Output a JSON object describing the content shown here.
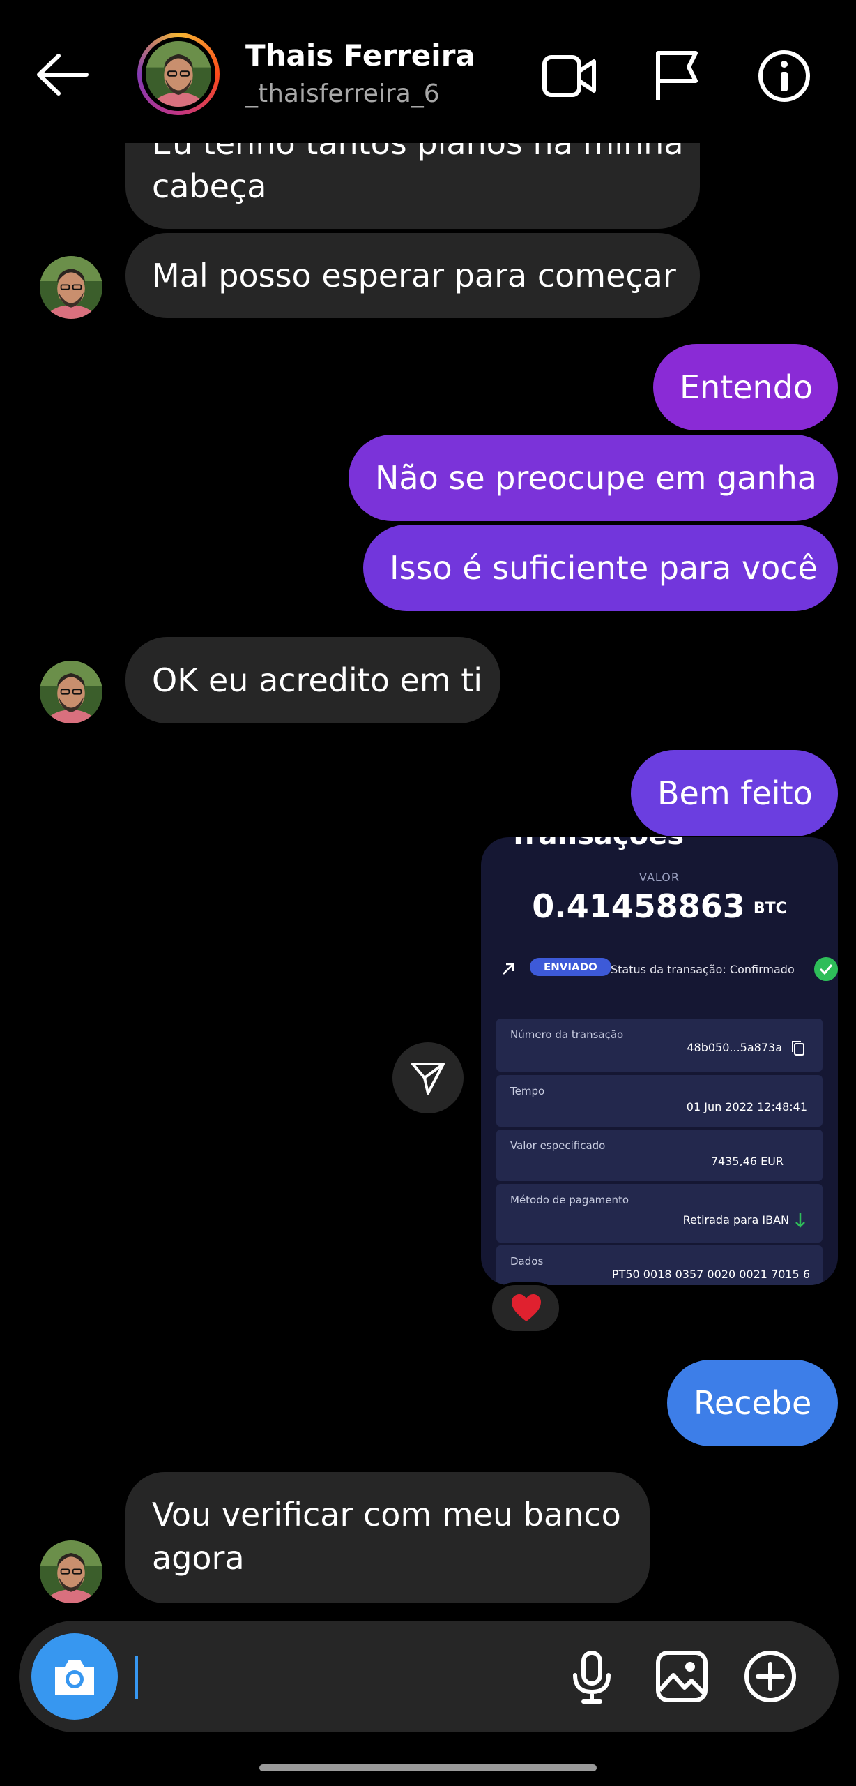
{
  "header": {
    "name": "Thais Ferreira",
    "handle": "_thaisferreira_6",
    "icons": [
      "back-arrow-icon",
      "video-call-icon",
      "report-flag-icon",
      "info-icon"
    ]
  },
  "messages": {
    "m1_line1": "Eu tenho tantos planos na minha",
    "m1_line2": "cabeça",
    "m2": "Mal posso esperar para começar",
    "m3": "Entendo",
    "m4": "Não se preocupe em ganha",
    "m5": "Isso é suficiente para você",
    "m6": "OK eu acredito em ti",
    "m7": "Bem feito",
    "m8": "Recebe",
    "m9_line1": "Vou verificar com meu banco",
    "m9_line2": "agora"
  },
  "colors": {
    "incoming": "#262626",
    "outgoing_purple": "#8a2bd6",
    "outgoing_violet": "#6b3ee0",
    "outgoing_blue": "#3d7ee8",
    "accent": "#3797f0"
  },
  "transaction": {
    "header_cut": "Transações",
    "value_label": "VALOR",
    "amount": "0.41458863",
    "currency": "BTC",
    "sent_badge": "ENVIADO",
    "status": "Status da transação: Confirmado",
    "rows": [
      {
        "label": "Número da transação",
        "value": "48b050...5a873a"
      },
      {
        "label": "Tempo",
        "value": "01 Jun 2022 12:48:41"
      },
      {
        "label": "Valor especificado",
        "value": "7435,46 EUR"
      },
      {
        "label": "Método de pagamento",
        "value": "Retirada para IBAN"
      },
      {
        "label": "Dados",
        "value": "PT50 0018 0357 0020 0021 7015 6"
      }
    ]
  },
  "reaction": "❤️",
  "composer": {
    "icons": [
      "camera-icon",
      "microphone-icon",
      "gallery-icon",
      "add-icon"
    ]
  }
}
